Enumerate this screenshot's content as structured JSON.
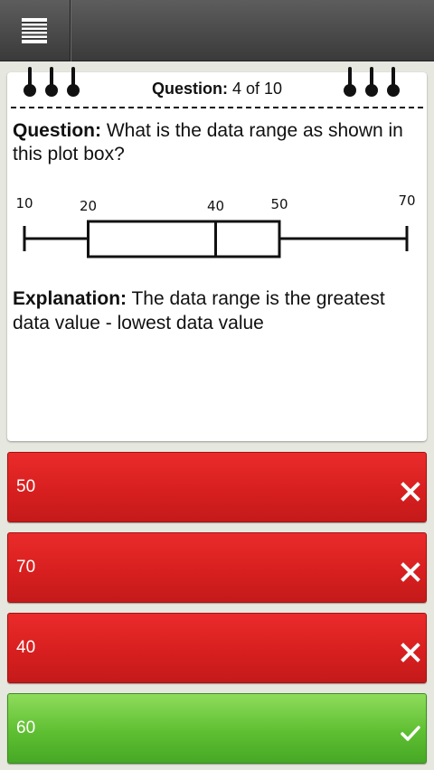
{
  "header": {
    "question_label": "Question:",
    "progress": "4 of 10"
  },
  "question": {
    "label": "Question:",
    "text": "What is the data range as shown in this plot box?"
  },
  "chart_data": {
    "type": "boxplot",
    "min": 10,
    "q1": 20,
    "median": 40,
    "q3": 50,
    "max": 70,
    "tick_labels": [
      "10",
      "20",
      "40",
      "50",
      "70"
    ]
  },
  "explanation": {
    "label": "Explanation:",
    "text": "The data range is the greatest data value - lowest data value"
  },
  "answers": [
    {
      "label": "50",
      "correct": false
    },
    {
      "label": "70",
      "correct": false
    },
    {
      "label": "40",
      "correct": false
    },
    {
      "label": "60",
      "correct": true
    }
  ],
  "colors": {
    "wrong": "#d81f1f",
    "correct": "#5fbf32",
    "topbar": "#4a4a4a"
  }
}
